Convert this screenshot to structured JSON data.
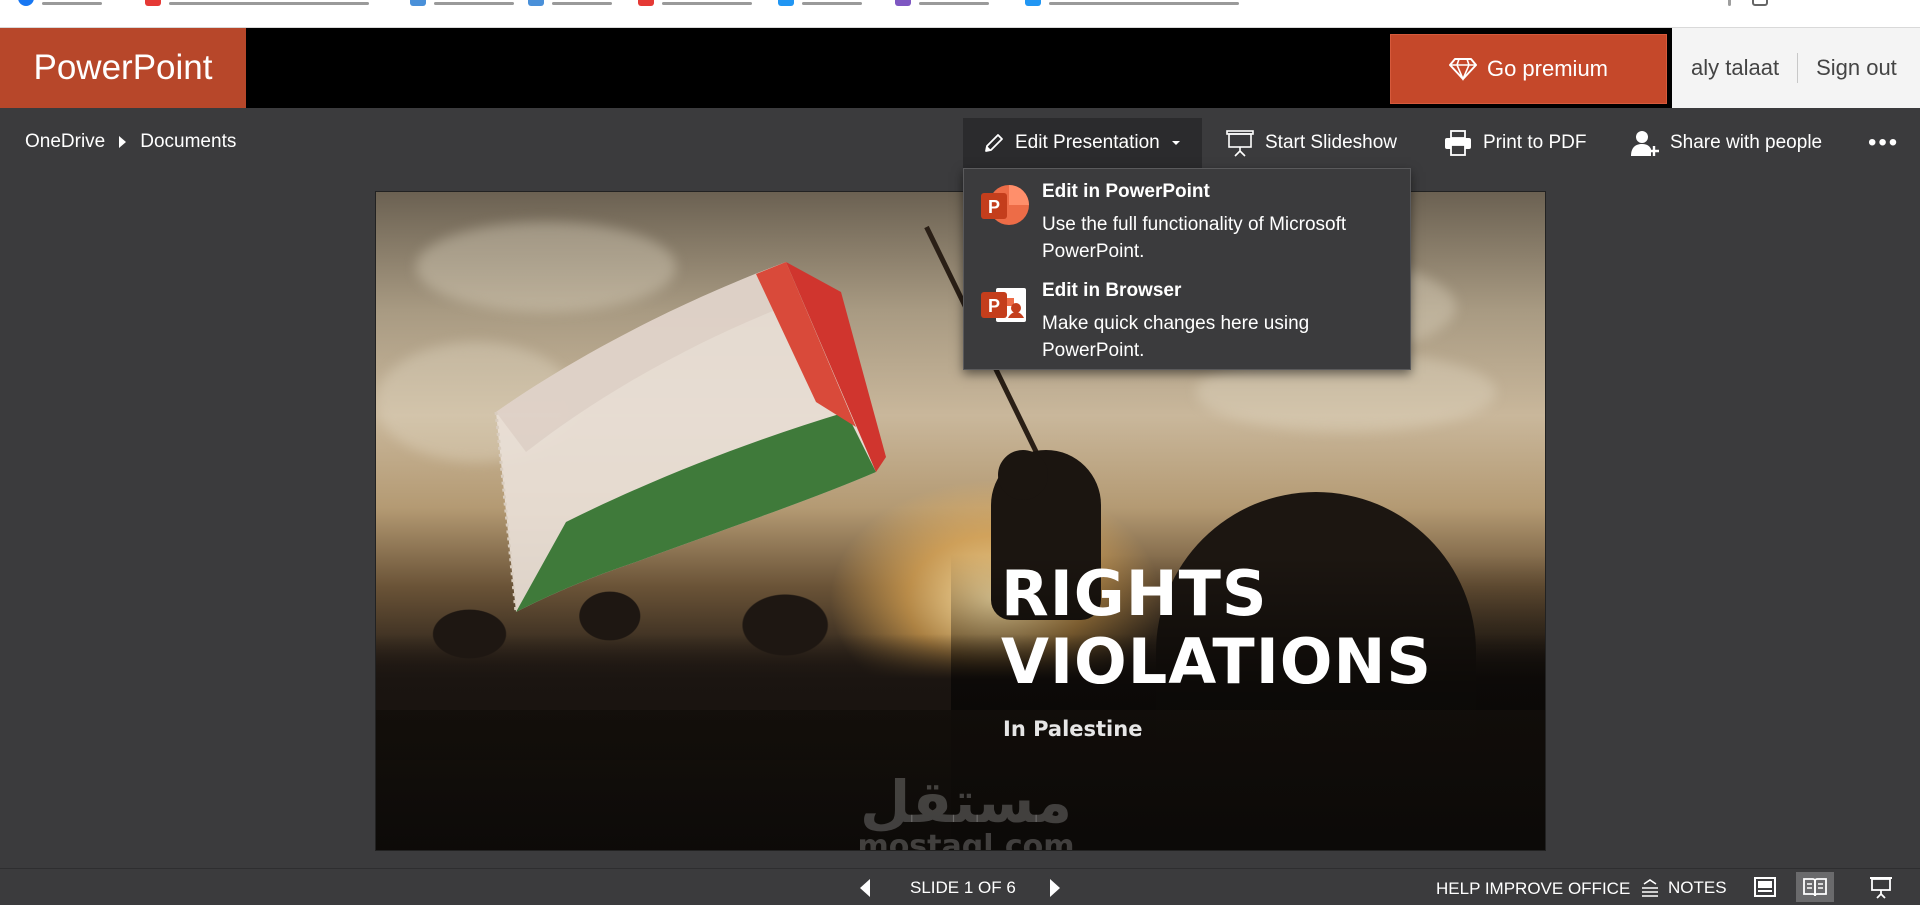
{
  "app": {
    "brand": "PowerPoint",
    "premium_label": "Go premium",
    "user_name": "aly talaat",
    "sign_out": "Sign out",
    "accent_color": "#b7472a"
  },
  "breadcrumb": {
    "items": [
      "OneDrive",
      "Documents"
    ]
  },
  "commands": {
    "edit": "Edit Presentation",
    "slideshow": "Start Slideshow",
    "print": "Print to PDF",
    "share": "Share with people",
    "more": "•••"
  },
  "edit_menu": {
    "items": [
      {
        "title": "Edit in PowerPoint",
        "desc": "Use the full functionality of Microsoft PowerPoint.",
        "icon": "powerpoint-app-icon"
      },
      {
        "title": "Edit in Browser",
        "desc": "Make quick changes here using PowerPoint.",
        "icon": "powerpoint-online-icon"
      }
    ]
  },
  "slide": {
    "title_line1": "RIGHTS",
    "title_line2": "VIOLATIONS",
    "subtitle": "In Palestine",
    "watermark_ar": "مستقل",
    "watermark_en": "mostaql.com"
  },
  "status": {
    "slide_counter": "SLIDE 1 OF 6",
    "help": "HELP IMPROVE OFFICE",
    "notes": "NOTES"
  }
}
